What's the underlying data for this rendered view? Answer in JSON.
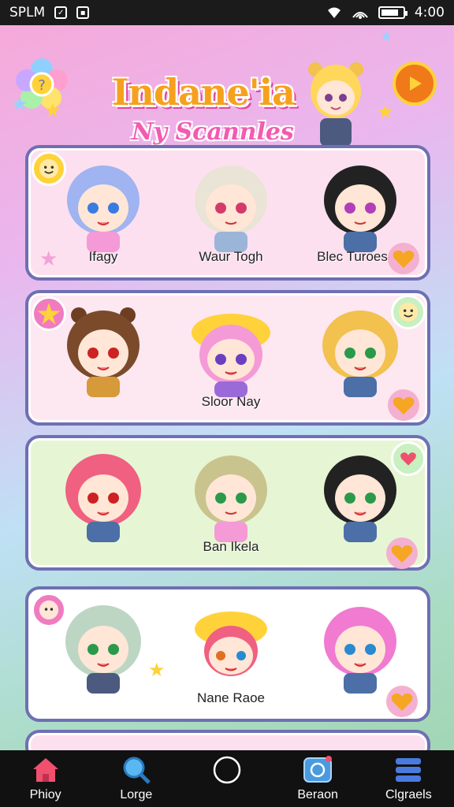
{
  "status_bar": {
    "carrier": "SPLM",
    "time": "4:00",
    "battery_level": 0.8
  },
  "header": {
    "title": "Indane'ia",
    "subtitle": "Ny Scannles"
  },
  "cards": [
    {
      "captions": [
        "Ifagy",
        "Waur Togh",
        "Blec Turoes"
      ]
    },
    {
      "captions": [
        "",
        "Sloor Nay",
        ""
      ]
    },
    {
      "captions": [
        "",
        "Ban Ikela",
        ""
      ]
    },
    {
      "captions": [
        "",
        "Nane Raoe",
        ""
      ]
    }
  ],
  "nav": {
    "items": [
      {
        "label": "Phioy",
        "icon": "home-icon"
      },
      {
        "label": "Lorge",
        "icon": "search-icon"
      },
      {
        "label": "",
        "icon": "circle-icon"
      },
      {
        "label": "Beraon",
        "icon": "camera-icon"
      },
      {
        "label": "Clgraels",
        "icon": "menu-icon"
      }
    ]
  },
  "colors": {
    "title": "#f6a11e",
    "subtitle": "#f25bb0",
    "card_border": "#6f6fb3",
    "heart": "#f5a623"
  }
}
